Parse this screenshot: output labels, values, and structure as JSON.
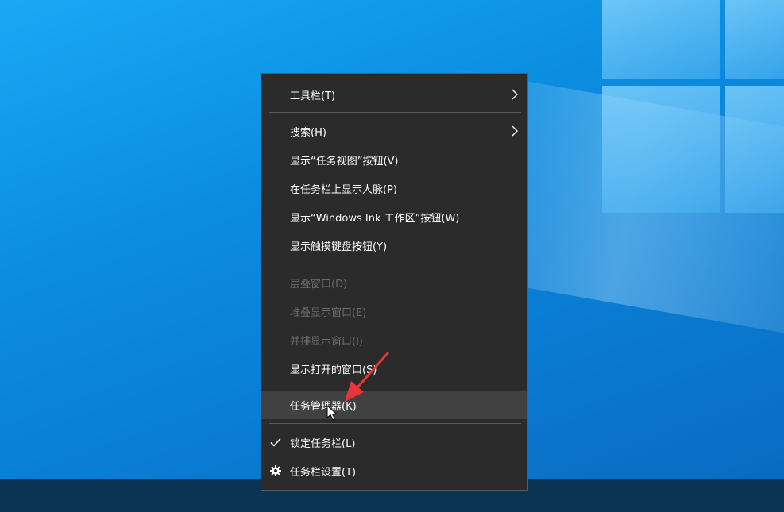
{
  "menu": {
    "items": [
      {
        "label": "工具栏(T)",
        "has_submenu": true,
        "state": "normal"
      },
      {
        "label": "搜索(H)",
        "has_submenu": true,
        "state": "normal"
      },
      {
        "label": "显示“任务视图”按钮(V)",
        "state": "normal"
      },
      {
        "label": "在任务栏上显示人脉(P)",
        "state": "normal"
      },
      {
        "label": "显示“Windows Ink 工作区”按钮(W)",
        "state": "normal"
      },
      {
        "label": "显示触摸键盘按钮(Y)",
        "state": "normal"
      },
      {
        "label": "层叠窗口(D)",
        "state": "disabled"
      },
      {
        "label": "堆叠显示窗口(E)",
        "state": "disabled"
      },
      {
        "label": "并排显示窗口(I)",
        "state": "disabled"
      },
      {
        "label": "显示打开的窗口(S)",
        "state": "normal"
      },
      {
        "label": "任务管理器(K)",
        "state": "hover"
      },
      {
        "label": "锁定任务栏(L)",
        "state": "checked",
        "icon": "checkmark-icon"
      },
      {
        "label": "任务栏设置(T)",
        "state": "normal",
        "icon": "gear-icon"
      }
    ]
  },
  "colors": {
    "menu_bg": "#2b2b2b",
    "menu_text": "#ffffff",
    "disabled_text": "#6d6d6d",
    "hover_bg": "#414141",
    "separator": "#5c5c5c",
    "annotation_arrow": "#e8353a",
    "taskbar": "#0a3451",
    "desktop": "#0b8de0"
  }
}
